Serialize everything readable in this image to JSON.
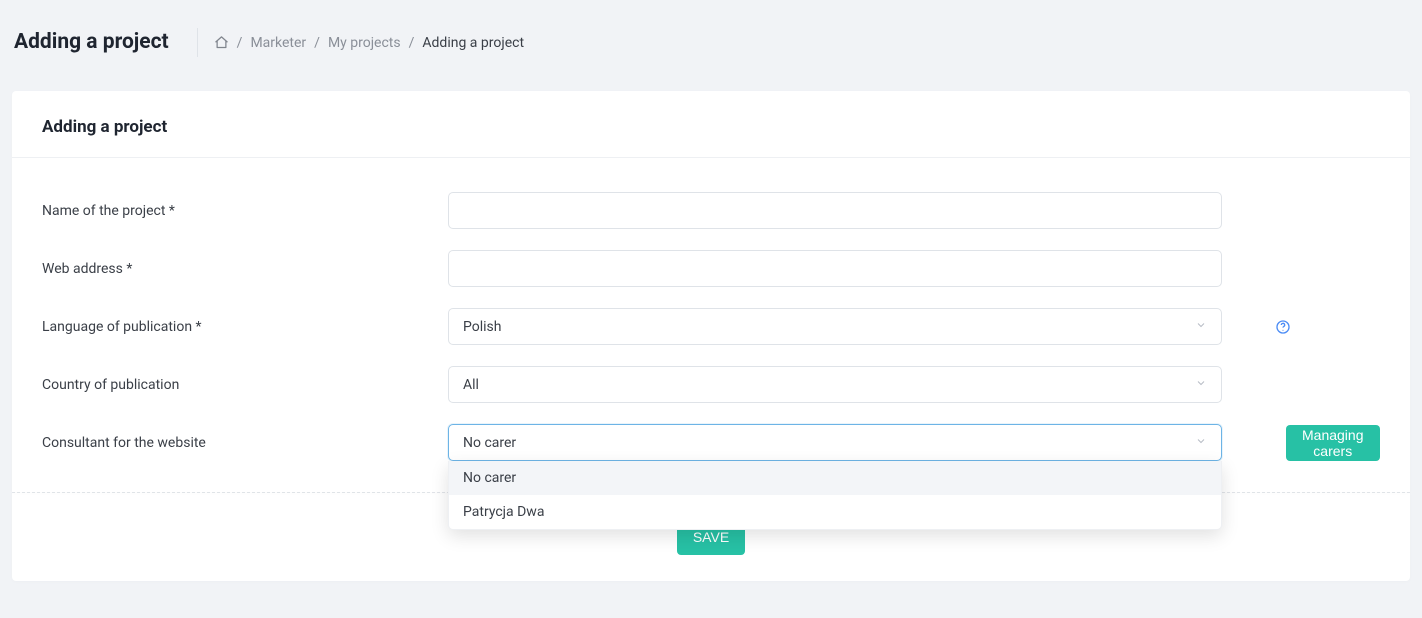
{
  "page": {
    "title": "Adding a project",
    "card_title": "Adding a project"
  },
  "breadcrumb": {
    "items": [
      {
        "label": "Marketer"
      },
      {
        "label": "My projects"
      }
    ],
    "current": "Adding a project"
  },
  "form": {
    "name": {
      "label": "Name of the project *",
      "value": ""
    },
    "web": {
      "label": "Web address *",
      "value": ""
    },
    "lang": {
      "label": "Language of publication *",
      "selected": "Polish"
    },
    "country": {
      "label": "Country of publication",
      "selected": "All"
    },
    "consultant": {
      "label": "Consultant for the website",
      "selected": "No carer",
      "options": [
        "No carer",
        "Patrycja Dwa"
      ]
    }
  },
  "buttons": {
    "managing_carers": "Managing carers",
    "save": "SAVE"
  }
}
